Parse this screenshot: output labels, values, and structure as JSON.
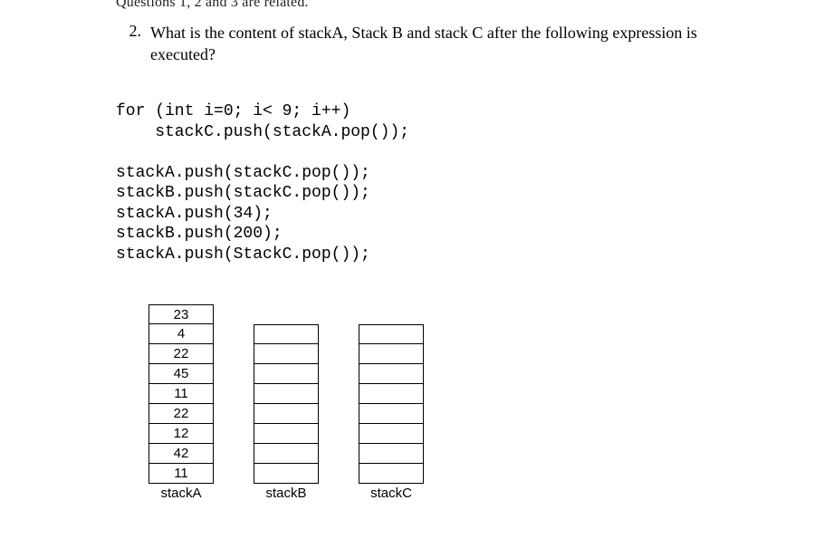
{
  "partial_header": "Questions 1, 2 and 3 are related.",
  "question": {
    "number": "2.",
    "text_line1": "What is the content of stackA, Stack B and stack C after the following expression is",
    "text_line2": "executed?"
  },
  "code": {
    "l1": "for (int i=0; i< 9; i++)",
    "l2": "    stackC.push(stackA.pop());",
    "l3": "",
    "l4": "stackA.push(stackC.pop());",
    "l5": "stackB.push(stackC.pop());",
    "l6": "stackA.push(34);",
    "l7": "stackB.push(200);",
    "l8": "stackA.push(StackC.pop());"
  },
  "stacks": {
    "A": {
      "label": "stackA",
      "cells": [
        "23",
        "4",
        "22",
        "45",
        "11",
        "22",
        "12",
        "42",
        "11"
      ]
    },
    "B": {
      "label": "stackB",
      "cells": [
        "",
        "",
        "",
        "",
        "",
        "",
        "",
        ""
      ]
    },
    "C": {
      "label": "stackC",
      "cells": [
        "",
        "",
        "",
        "",
        "",
        "",
        "",
        ""
      ]
    }
  }
}
